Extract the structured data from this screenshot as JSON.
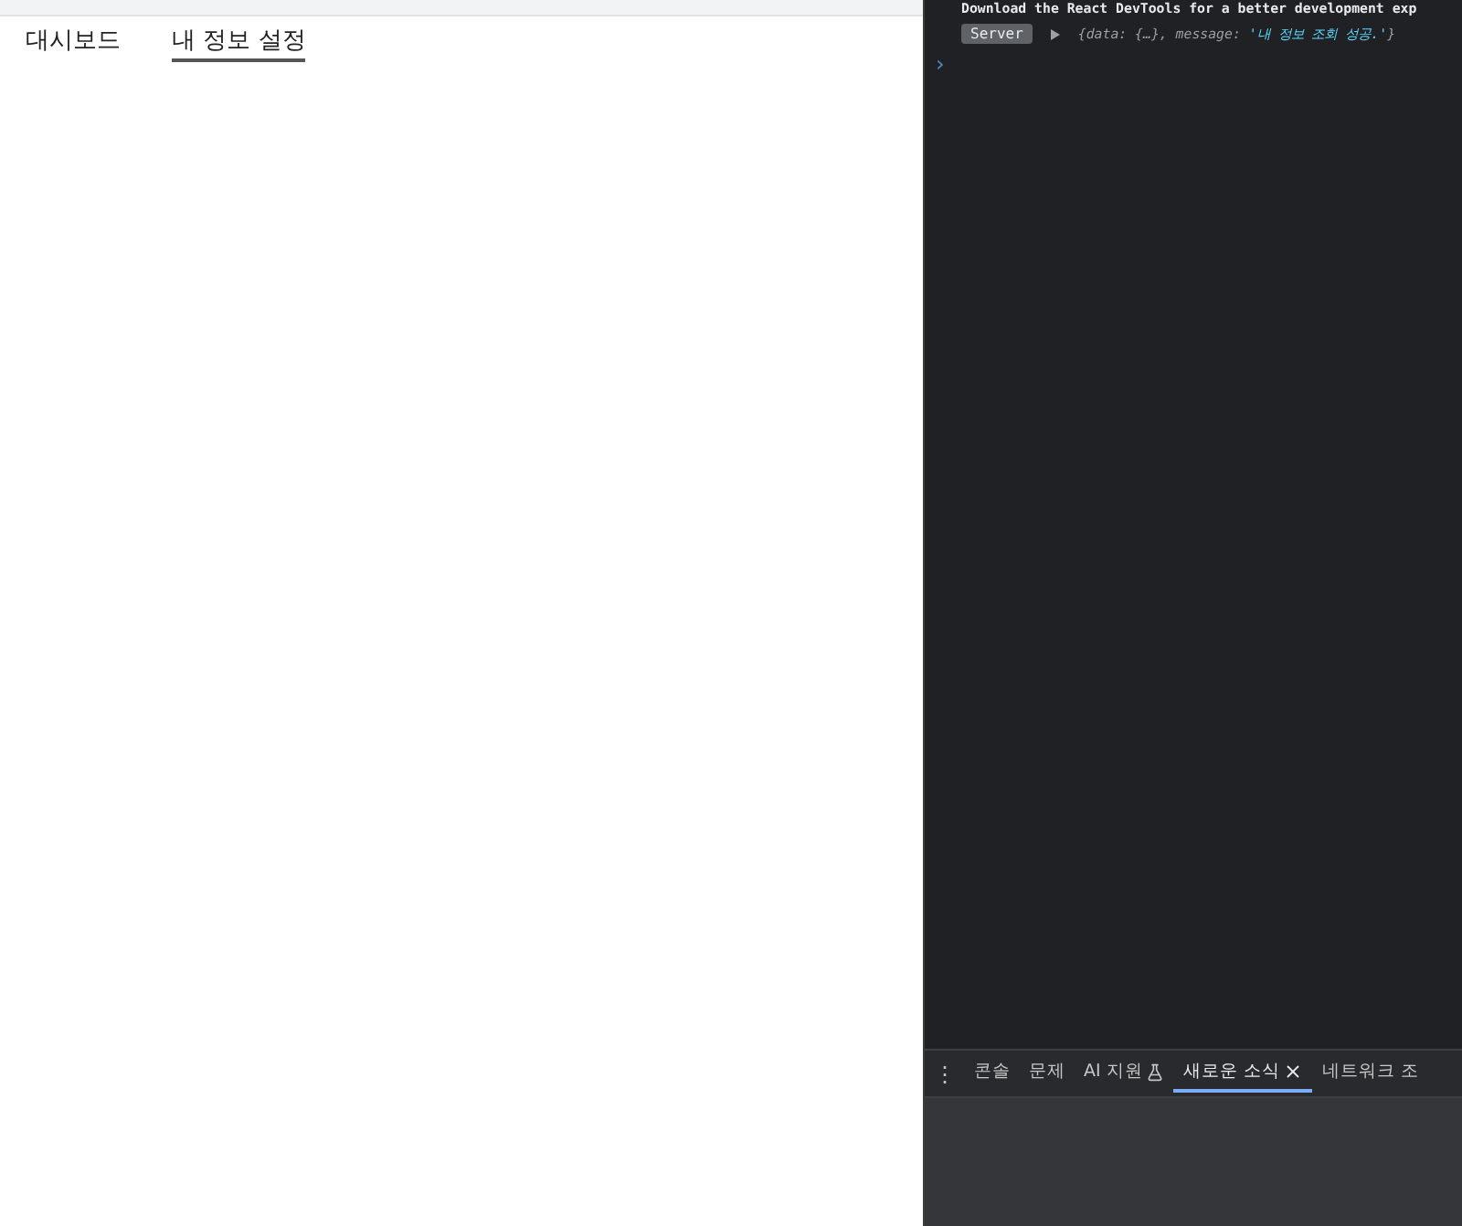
{
  "nav": [
    {
      "label": "대시보드",
      "selected": false
    },
    {
      "label": "내 정보 설정",
      "selected": true
    }
  ],
  "console": {
    "banner": "Download the React DevTools for a better development exp",
    "entries": [
      {
        "badge": "Server",
        "object_prefix": "{data: {…}, message: ",
        "message": "'내 정보 조회 성공.'",
        "object_suffix": "}"
      }
    ],
    "prompt": "›"
  },
  "drawer": {
    "menu": "⋮",
    "tabs": [
      {
        "label": "콘솔",
        "selected": false,
        "closable": false,
        "experimental": false
      },
      {
        "label": "문제",
        "selected": false,
        "closable": false,
        "experimental": false
      },
      {
        "label": "AI 지원",
        "selected": false,
        "closable": false,
        "experimental": true
      },
      {
        "label": "새로운 소식",
        "selected": true,
        "closable": true,
        "experimental": false
      },
      {
        "label": "네트워크 조",
        "selected": false,
        "closable": false,
        "experimental": false
      }
    ]
  }
}
